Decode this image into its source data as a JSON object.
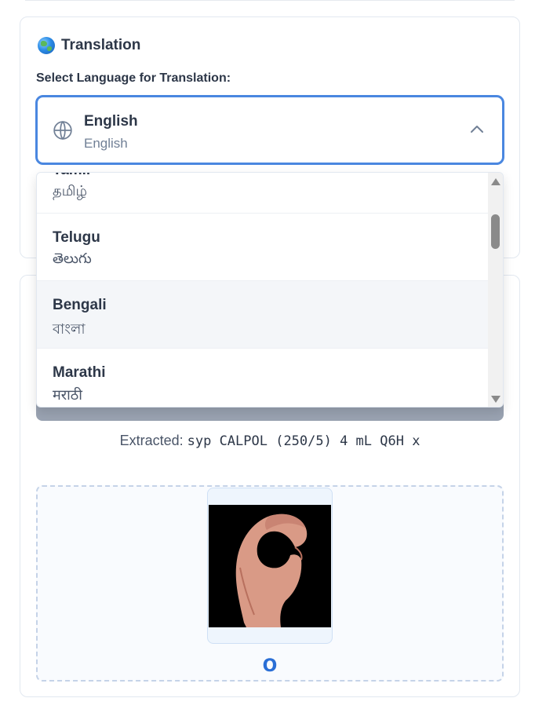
{
  "translation": {
    "title": "Translation",
    "title_icon": "globe-emoji-icon",
    "select_label": "Select Language for Translation:",
    "selected": {
      "name": "English",
      "native": "English"
    },
    "options": [
      {
        "name": "Tamil",
        "native": "தமிழ்"
      },
      {
        "name": "Telugu",
        "native": "తెలుగు"
      },
      {
        "name": "Bengali",
        "native": "বাংলা"
      },
      {
        "name": "Marathi",
        "native": "मराठी"
      }
    ],
    "hovered_option": "Bengali"
  },
  "extraction": {
    "label": "Extracted:",
    "value": "syp CALPOL (250/5) 4 mL Q6H x"
  },
  "sign": {
    "letter": "O",
    "image_icon": "hand-sign-o-icon"
  },
  "colors": {
    "accent": "#4a87e0",
    "letter": "#2b6fd6",
    "muted_bar": "#9aa3b2"
  }
}
